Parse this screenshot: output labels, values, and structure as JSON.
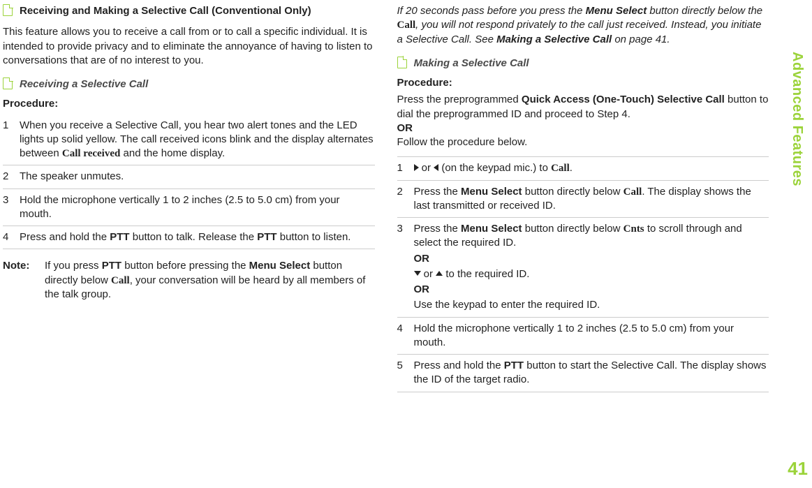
{
  "sidebar": {
    "label": "Advanced Features",
    "page_number": "41"
  },
  "left": {
    "section_title": "Receiving and Making a Selective Call (Conventional Only)",
    "intro": "This feature allows you to receive a call from or to call a specific individual. It is intended to provide privacy and to eliminate the annoyance of having to listen to conversations that are of no interest to you.",
    "sub_title": "Receiving a Selective Call",
    "procedure_label": "Procedure:",
    "steps": {
      "s1_a": "When you receive a Selective Call, you hear two alert tones and the LED lights up solid yellow. The call received icons blink and the display alternates between ",
      "s1_ui": "Call received",
      "s1_b": " and the home display.",
      "s2": "The speaker unmutes.",
      "s3": "Hold the microphone vertically 1 to 2 inches (2.5 to 5.0 cm) from your mouth.",
      "s4_a": "Press and hold the ",
      "s4_ptt1": "PTT",
      "s4_b": " button to talk. Release the ",
      "s4_ptt2": "PTT",
      "s4_c": " button to listen."
    },
    "note": {
      "label": "Note:",
      "a": "If you press ",
      "ptt": "PTT",
      "b": " button before pressing the ",
      "menu": "Menu Select",
      "c": " button directly below ",
      "call_ui": "Call",
      "d": ", your conversation will be heard by all members of the talk group."
    }
  },
  "right": {
    "italic": {
      "a": "If 20 seconds pass before you press the ",
      "menu": "Menu Select",
      "b": " button directly below the ",
      "call_ui": "Call",
      "c": ", you will not respond privately to the call just received. Instead, you initiate a Selective Call. See ",
      "ref": "Making a Selective Call",
      "d": " on page 41."
    },
    "sub_title": "Making a Selective Call",
    "procedure_label": "Procedure:",
    "pre": {
      "a": "Press the preprogrammed ",
      "btn": "Quick Access (One-Touch) Selective Call",
      "b": " button to dial the preprogrammed ID and proceed to Step 4.",
      "or": "OR",
      "c": "Follow the procedure below."
    },
    "steps": {
      "s1_mid": " or ",
      "s1_end": " (on the keypad mic.) to ",
      "s1_call": "Call",
      "s1_dot": ".",
      "s2_a": "Press the ",
      "s2_menu": "Menu Select",
      "s2_b": " button directly below ",
      "s2_call": "Call",
      "s2_c": ". The display shows the last transmitted or received ID.",
      "s3_a": "Press the ",
      "s3_menu": "Menu Select",
      "s3_b": " button directly below ",
      "s3_cnts": "Cnts",
      "s3_c": " to scroll through and select the required ID.",
      "s3_or": "OR",
      "s3_arrows_mid": " or ",
      "s3_arrows_end": " to the required ID.",
      "s3_or2": "OR",
      "s3_d": "Use the keypad to enter the required ID.",
      "s4": "Hold the microphone vertically 1 to 2 inches (2.5 to 5.0 cm) from your mouth.",
      "s5_a": "Press and hold the ",
      "s5_ptt": "PTT",
      "s5_b": " button to start the Selective Call. The display shows the ID of the target radio."
    }
  }
}
